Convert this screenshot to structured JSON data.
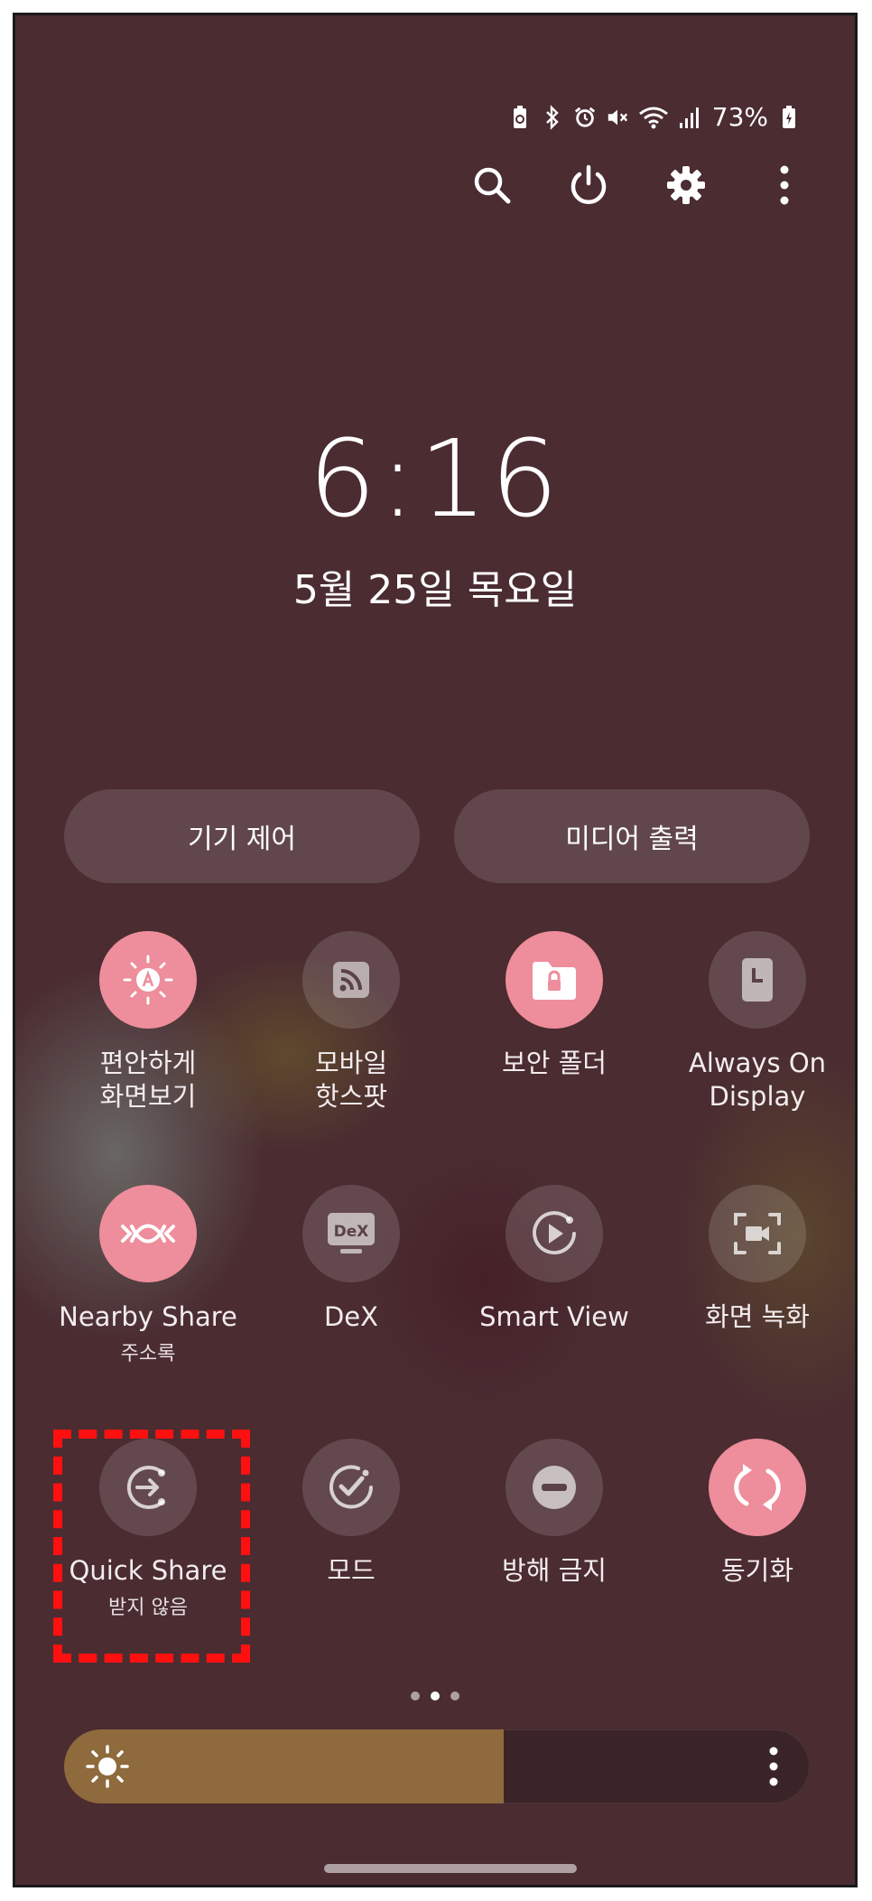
{
  "status_bar": {
    "battery_percent": "73%",
    "icons": [
      "battery-saver-icon",
      "bluetooth-icon",
      "alarm-icon",
      "mute-icon",
      "wifi-icon",
      "signal-icon",
      "battery-icon"
    ]
  },
  "top_actions": [
    "search-icon",
    "power-icon",
    "gear-icon",
    "more-vertical-icon"
  ],
  "clock": {
    "time": "6:16",
    "date": "5월 25일 목요일"
  },
  "pills": {
    "device_control": "기기 제어",
    "media_output": "미디어 출력"
  },
  "tiles": [
    {
      "label1": "편안하게",
      "label2": "화면보기",
      "sub": "",
      "on": true,
      "icon": "eye-comfort-icon"
    },
    {
      "label1": "모바일",
      "label2": "핫스팟",
      "sub": "",
      "on": false,
      "icon": "hotspot-icon"
    },
    {
      "label1": "보안 폴더",
      "label2": "",
      "sub": "",
      "on": true,
      "icon": "secure-folder-icon"
    },
    {
      "label1": "Always On",
      "label2": "Display",
      "sub": "",
      "on": false,
      "icon": "always-on-display-icon"
    },
    {
      "label1": "Nearby Share",
      "label2": "",
      "sub": "주소록",
      "on": true,
      "icon": "nearby-share-icon"
    },
    {
      "label1": "DeX",
      "label2": "",
      "sub": "",
      "on": false,
      "icon": "dex-icon",
      "icon_text": "DeX"
    },
    {
      "label1": "Smart View",
      "label2": "",
      "sub": "",
      "on": false,
      "icon": "smart-view-icon"
    },
    {
      "label1": "화면 녹화",
      "label2": "",
      "sub": "",
      "on": false,
      "icon": "screen-record-icon"
    },
    {
      "label1": "Quick Share",
      "label2": "",
      "sub": "받지 않음",
      "on": false,
      "icon": "quick-share-icon"
    },
    {
      "label1": "모드",
      "label2": "",
      "sub": "",
      "on": false,
      "icon": "modes-icon"
    },
    {
      "label1": "방해 금지",
      "label2": "",
      "sub": "",
      "on": false,
      "icon": "do-not-disturb-icon"
    },
    {
      "label1": "동기화",
      "label2": "",
      "sub": "",
      "on": true,
      "icon": "sync-icon"
    }
  ],
  "page_indicator": {
    "count": 3,
    "active": 1
  },
  "brightness": {
    "level": 0.59
  },
  "colors": {
    "background": "#4a2c31",
    "tile_active": "#ee8d9b",
    "brightness_fill": "#8e6a3c",
    "highlight": "#ff1010"
  }
}
